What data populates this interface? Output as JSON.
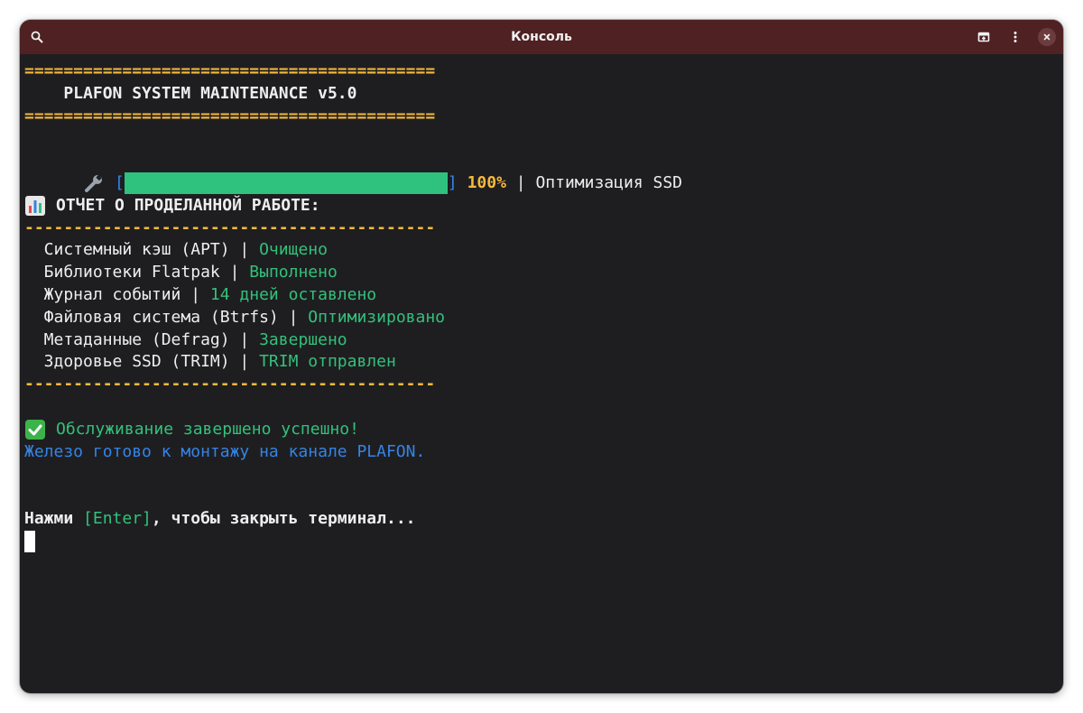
{
  "window": {
    "title": "Консоль",
    "icons": {
      "search": "search-icon",
      "new_tab": "new-tab-icon",
      "menu": "kebab-menu-icon",
      "close": "close-icon"
    }
  },
  "colors": {
    "titlebar": "#4f2123",
    "terminal_bg": "#1e1e21",
    "yellow": "#f6b93b",
    "green": "#33c17a",
    "blue": "#3584e4",
    "bar_fill": "#2ec27e"
  },
  "terminal": {
    "separator_double": "==========================================",
    "header_title": "    PLAFON SYSTEM MAINTENANCE v5.0",
    "progress": {
      "icon": "wrench-icon",
      "bracket_open": "[",
      "bracket_close": "]",
      "value": 1.0,
      "percent_label": "100%",
      "divider": " | ",
      "task": "Оптимизация SSD"
    },
    "report": {
      "icon": "bar-chart-icon",
      "title": "ОТЧЕТ О ПРОДЕЛАННОЙ РАБОТЕ:",
      "separator_dash": "------------------------------------------",
      "items": [
        {
          "label": "  Системный кэш (APT)",
          "sep": " | ",
          "status": "Очищено"
        },
        {
          "label": "  Библиотеки Flatpak",
          "sep": " | ",
          "status": "Выполнено"
        },
        {
          "label": "  Журнал событий",
          "sep": " | ",
          "status": "14 дней оставлено"
        },
        {
          "label": "  Файловая система (Btrfs)",
          "sep": " | ",
          "status": "Оптимизировано"
        },
        {
          "label": "  Метаданные (Defrag)",
          "sep": " | ",
          "status": "Завершено"
        },
        {
          "label": "  Здоровье SSD (TRIM)",
          "sep": " | ",
          "status": "TRIM отправлен"
        }
      ]
    },
    "success": {
      "icon": "check-mark-icon",
      "message": "Обслуживание завершено успешно!"
    },
    "hardware_ready": "Железо готово к монтажу на канале PLAFON.",
    "prompt": {
      "prefix": "Нажми ",
      "key": "[Enter]",
      "suffix": ", чтобы закрыть терминал..."
    }
  }
}
